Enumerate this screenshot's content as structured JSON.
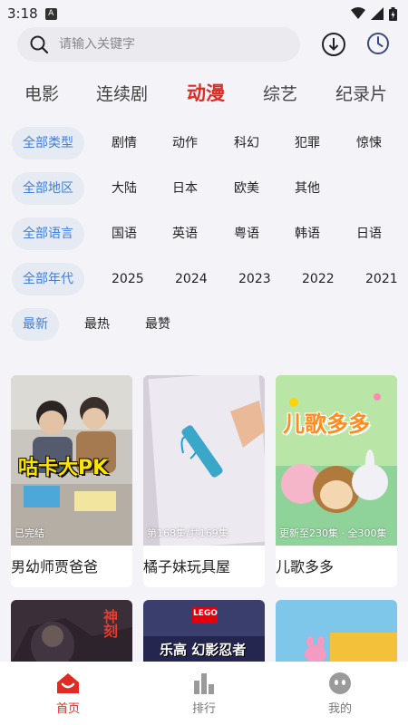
{
  "status": {
    "time": "3:18",
    "badge": "A"
  },
  "search": {
    "placeholder": "请输入关键字"
  },
  "categories": [
    {
      "label": "电影",
      "active": false
    },
    {
      "label": "连续剧",
      "active": false
    },
    {
      "label": "动漫",
      "active": true
    },
    {
      "label": "综艺",
      "active": false
    },
    {
      "label": "纪录片",
      "active": false
    }
  ],
  "filters": {
    "type": [
      "全部类型",
      "剧情",
      "动作",
      "科幻",
      "犯罪",
      "惊悚"
    ],
    "region": [
      "全部地区",
      "大陆",
      "日本",
      "欧美",
      "其他"
    ],
    "language": [
      "全部语言",
      "国语",
      "英语",
      "粤语",
      "韩语",
      "日语"
    ],
    "year": [
      "全部年代",
      "2025",
      "2024",
      "2023",
      "2022",
      "2021"
    ],
    "sort": [
      "最新",
      "最热",
      "最赞"
    ]
  },
  "cards": [
    {
      "title": "男幼师贾爸爸",
      "badge": "已完结",
      "thumb_text": "咕卡大PK"
    },
    {
      "title": "橘子妹玩具屋",
      "badge": "第168集/共169集"
    },
    {
      "title": "儿歌多多",
      "badge": "更新至230集 · 全300集",
      "thumb_text": "儿歌多多"
    }
  ],
  "cards_row2": [
    {
      "thumb_text": "神刻"
    },
    {
      "thumb_text": "乐高 幻影忍者",
      "logo": "LEGO"
    },
    {
      "thumb_text": ""
    }
  ],
  "nav": [
    {
      "label": "首页",
      "active": true,
      "icon": "home-icon"
    },
    {
      "label": "排行",
      "active": false,
      "icon": "ranking-icon"
    },
    {
      "label": "我的",
      "active": false,
      "icon": "profile-icon"
    }
  ],
  "colors": {
    "accent": "#e02b22",
    "chip_selected": "#3d7fe0",
    "chip_bg": "#e6eaf3",
    "page_bg": "#f4f3f8"
  }
}
